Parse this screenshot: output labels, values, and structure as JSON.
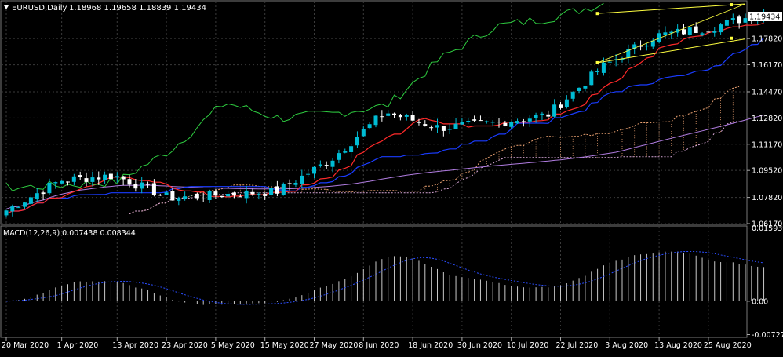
{
  "header": {
    "symbol": "EURUSD,Daily",
    "ohlc": "1.18968 1.19658 1.18839 1.19434"
  },
  "price_panel": {
    "current_price_label": "1.19434",
    "y_ticks": [
      "1.19434",
      "1.17820",
      "1.16170",
      "1.14470",
      "1.12820",
      "1.11170",
      "1.09520",
      "1.07820",
      "1.06170"
    ],
    "y_tick_values": [
      1.19434,
      1.1782,
      1.1617,
      1.1447,
      1.1282,
      1.1117,
      1.0952,
      1.0782,
      1.0617
    ],
    "ylim": [
      1.0617,
      1.2015
    ]
  },
  "macd_panel": {
    "label": "MACD(12,26,9) 0.007438 0.008344",
    "y_ticks": [
      "0.015939",
      "0.00",
      "-0.007271"
    ],
    "y_tick_values": [
      0.015939,
      0.0,
      -0.007271
    ],
    "ylim": [
      -0.0077,
      0.0162
    ]
  },
  "x_axis": {
    "tick_labels": [
      "20 Mar 2020",
      "1 Apr 2020",
      "13 Apr 2020",
      "23 Apr 2020",
      "5 May 2020",
      "15 May 2020",
      "27 May 2020",
      "8 Jun 2020",
      "18 Jun 2020",
      "30 Jun 2020",
      "10 Jul 2020",
      "22 Jul 2020",
      "3 Aug 2020",
      "13 Aug 2020",
      "25 Aug 2020"
    ],
    "tick_bar_index": [
      0,
      9,
      18,
      26,
      34,
      42,
      50,
      58,
      66,
      74,
      82,
      90,
      98,
      106,
      114
    ]
  },
  "colors": {
    "background": "#000000",
    "grid": "#3a3a3a",
    "axis_text": "#ffffff",
    "bull_candle": "#00bcd4",
    "bear_candle": "#ffffff",
    "tenkan": "#ff2a2a",
    "kijun": "#1a3cff",
    "chikou": "#2ecc40",
    "senkou_a": "#e8a070",
    "senkou_b": "#d9a9d9",
    "ma": "#b07ce0",
    "channel": "#ffff40",
    "macd_hist": "#c8c8c8",
    "macd_signal": "#2a4dff"
  },
  "chart_data": [
    {
      "type": "candlestick",
      "name": "EURUSD,Daily",
      "x": [
        "2020-03-20",
        "2020-04-01",
        "2020-04-13",
        "2020-04-23",
        "2020-05-05",
        "2020-05-15",
        "2020-05-27",
        "2020-06-08",
        "2020-06-18",
        "2020-06-30",
        "2020-07-10",
        "2020-07-22",
        "2020-08-03",
        "2020-08-13",
        "2020-08-25"
      ],
      "close_anchors": [
        1.07,
        1.089,
        1.092,
        1.078,
        1.08,
        1.082,
        1.102,
        1.132,
        1.122,
        1.125,
        1.13,
        1.16,
        1.18,
        1.185,
        1.1943
      ],
      "last_ohlc": [
        1.18968,
        1.19658,
        1.18839,
        1.19434
      ],
      "channel": {
        "upper": [
          [
            1.194,
            1.2
          ]
        ],
        "lower": [
          [
            1.163,
            1.178
          ]
        ]
      }
    },
    {
      "type": "bar",
      "name": "MACD(12,26,9)",
      "last_main": 0.007438,
      "last_signal": 0.008344,
      "ylim": [
        -0.007271,
        0.015939
      ]
    }
  ]
}
